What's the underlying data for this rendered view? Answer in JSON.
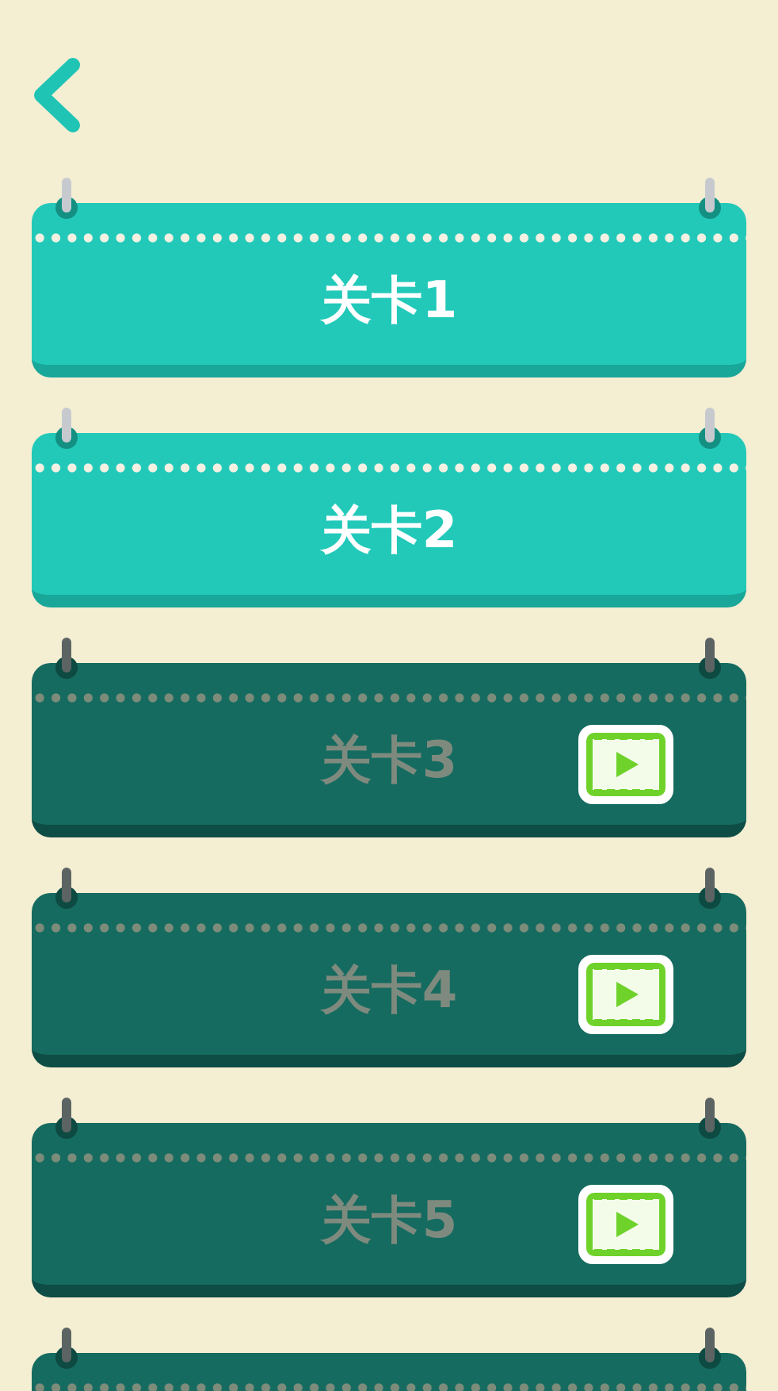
{
  "levels": [
    {
      "label": "关卡1",
      "locked": false
    },
    {
      "label": "关卡2",
      "locked": false
    },
    {
      "label": "关卡3",
      "locked": true
    },
    {
      "label": "关卡4",
      "locked": true
    },
    {
      "label": "关卡5",
      "locked": true
    },
    {
      "locked": true
    }
  ]
}
